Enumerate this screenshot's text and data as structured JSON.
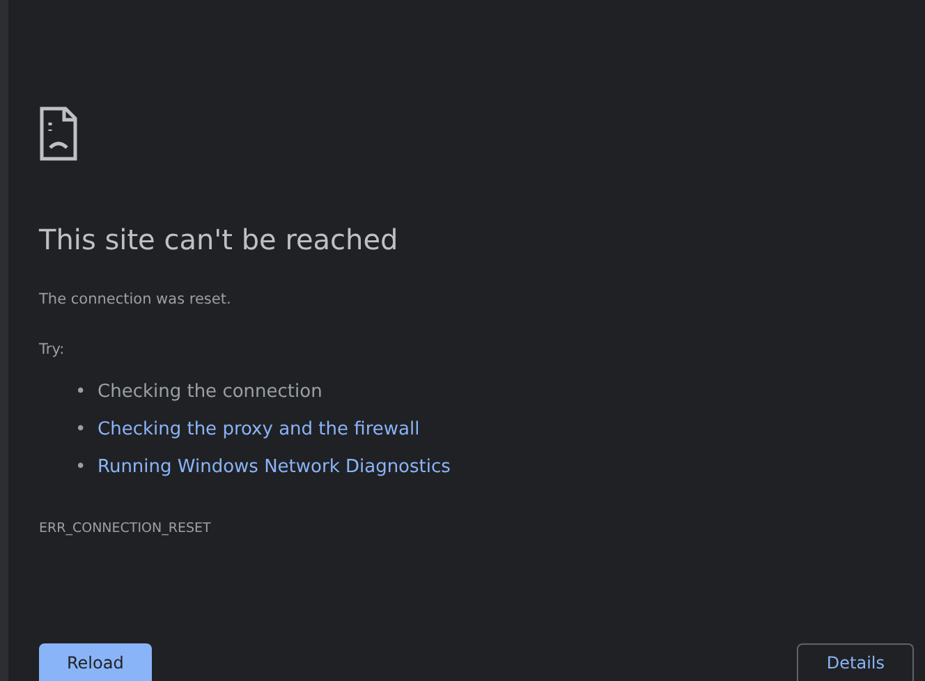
{
  "heading": "This site can't be reached",
  "message": "The connection was reset.",
  "suggestions_label": "Try:",
  "suggestions": [
    {
      "kind": "text",
      "bullet": "•",
      "text": "Checking the connection"
    },
    {
      "kind": "link",
      "bullet": "•",
      "text": "Checking the proxy and the firewall"
    },
    {
      "kind": "link",
      "bullet": "•",
      "text": "Running Windows Network Diagnostics"
    }
  ],
  "error_code": "ERR_CONNECTION_RESET",
  "buttons": [
    {
      "kind": "primary",
      "label": "Reload"
    },
    {
      "kind": "secondary",
      "label": "Details"
    }
  ]
}
